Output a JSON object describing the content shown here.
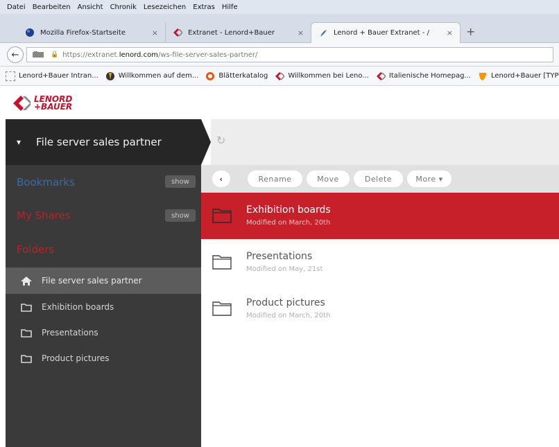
{
  "browser": {
    "menu": [
      "Datei",
      "Bearbeiten",
      "Ansicht",
      "Chronik",
      "Lesezeichen",
      "Extras",
      "Hilfe"
    ],
    "tabs": [
      {
        "label": "Mozilla Firefox-Startseite",
        "close": "×"
      },
      {
        "label": "Extranet - Lenord+Bauer",
        "close": "×"
      },
      {
        "label": "Lenord + Bauer Extranet - /",
        "close": "×"
      }
    ],
    "new_tab": "+",
    "url": {
      "prefix": "https://extranet.",
      "host": "lenord.com",
      "path": "/ws-file-server-sales-partner/"
    },
    "bookmarks": [
      "Lenord+Bauer Intran...",
      "Willkommen auf dem...",
      "Blätterkatalog",
      "Willkommen bei Leno...",
      "Italienische Homepag...",
      "Lenord+Bauer [TYPO..."
    ]
  },
  "logo": {
    "line1": "LENORD",
    "line2": "+BAUER"
  },
  "topbar": {
    "title": "File server sales partner",
    "refresh_icon": "refresh-icon"
  },
  "sidebar": {
    "bookmarks": {
      "label": "Bookmarks",
      "show": "show"
    },
    "shares": {
      "label": "My Shares",
      "show": "show"
    },
    "folders_label": "Folders",
    "items": [
      {
        "label": "File server sales partner",
        "icon": "home-icon"
      },
      {
        "label": "Exhibition boards",
        "icon": "folder-icon"
      },
      {
        "label": "Presentations",
        "icon": "folder-icon"
      },
      {
        "label": "Product pictures",
        "icon": "folder-icon"
      }
    ]
  },
  "actions": {
    "back": "‹",
    "rename": "Rename",
    "move": "Move",
    "delete": "Delete",
    "more": "More ▾"
  },
  "files": [
    {
      "name": "Exhibition boards",
      "modified": "Modified on March, 20th",
      "selected": true
    },
    {
      "name": "Presentations",
      "modified": "Modified on May, 21st",
      "selected": false
    },
    {
      "name": "Product pictures",
      "modified": "Modified on March, 20th",
      "selected": false
    }
  ],
  "colors": {
    "accent": "#c8202a",
    "sidebar_heading": "#3a6aa6",
    "sidebar_heading_alt": "#b0262c",
    "sidebar_bg": "#3a3a3a",
    "topbar_bg": "#262626"
  }
}
